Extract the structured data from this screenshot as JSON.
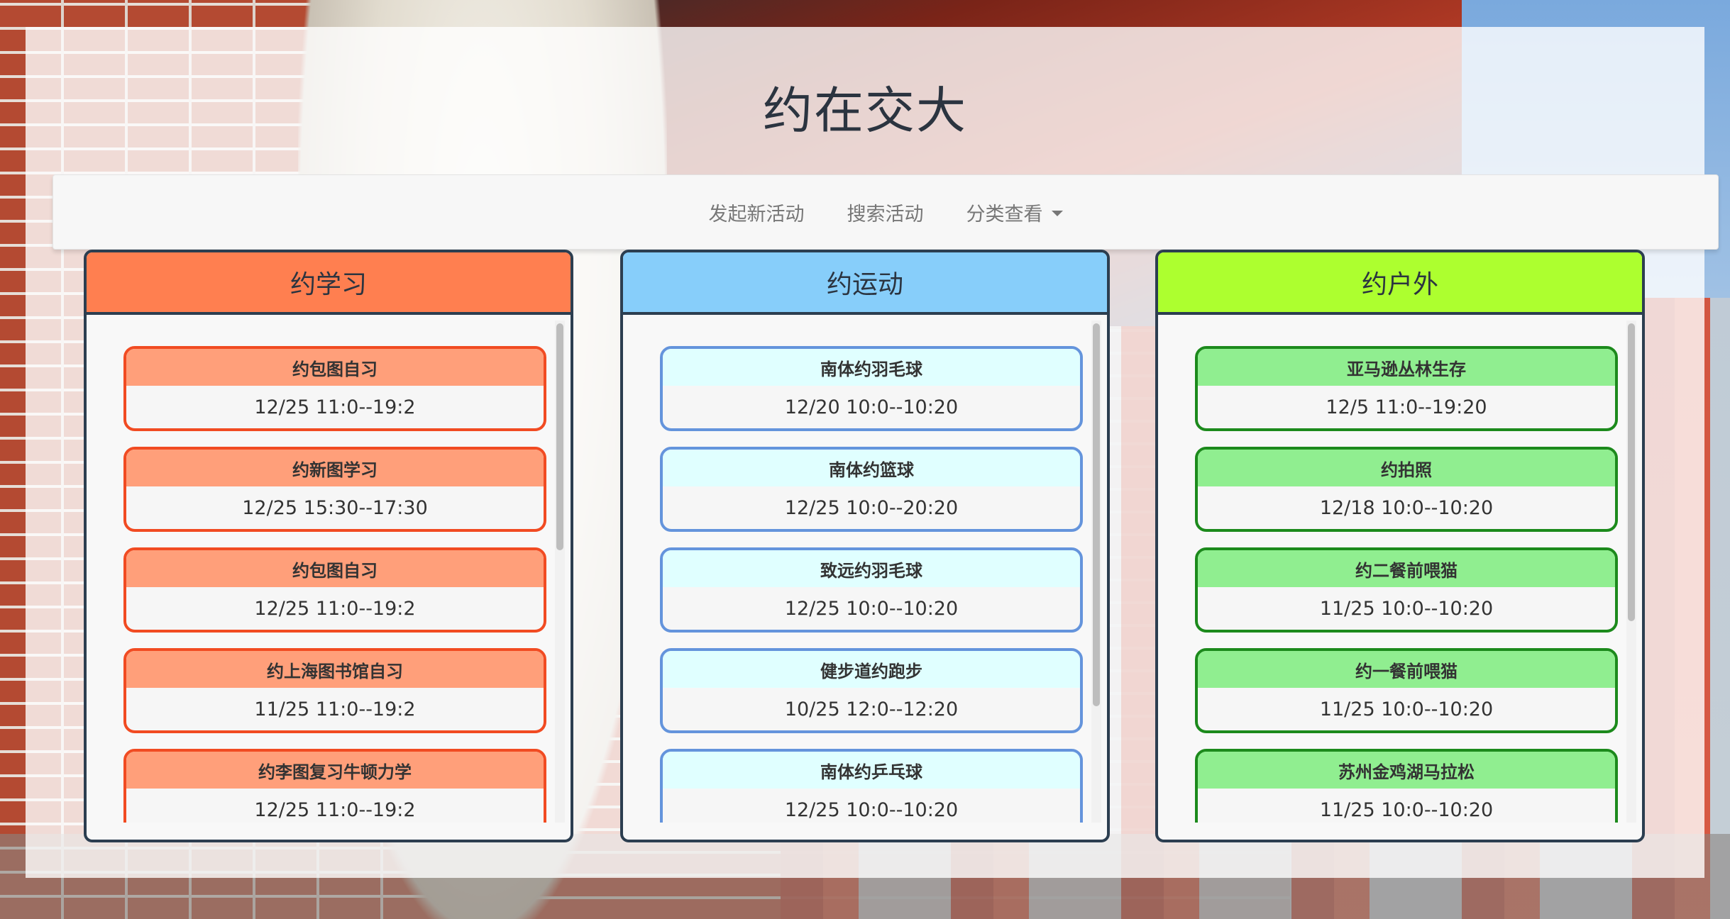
{
  "app": {
    "title": "约在交大"
  },
  "nav": {
    "items": [
      "发起新活动",
      "搜索活动"
    ],
    "dropdown_label": "分类查看"
  },
  "colors": {
    "study_header": "#ff7f50",
    "sport_header": "#87cefa",
    "outdoor_header": "#adff2f",
    "panel_border": "#2c3e50"
  },
  "columns": [
    {
      "title": "约学习",
      "activities": [
        {
          "name": "约包图自习",
          "time": "12/25 11:0--19:2"
        },
        {
          "name": "约新图学习",
          "time": "12/25 15:30--17:30"
        },
        {
          "name": "约包图自习",
          "time": "12/25 11:0--19:2"
        },
        {
          "name": "约上海图书馆自习",
          "time": "11/25 11:0--19:2"
        },
        {
          "name": "约李图复习牛顿力学",
          "time": "12/25 11:0--19:2"
        }
      ]
    },
    {
      "title": "约运动",
      "activities": [
        {
          "name": "南体约羽毛球",
          "time": "12/20 10:0--10:20"
        },
        {
          "name": "南体约篮球",
          "time": "12/25 10:0--20:20"
        },
        {
          "name": "致远约羽毛球",
          "time": "12/25 10:0--10:20"
        },
        {
          "name": "健步道约跑步",
          "time": "10/25 12:0--12:20"
        },
        {
          "name": "南体约乒乓球",
          "time": "12/25 10:0--10:20"
        }
      ]
    },
    {
      "title": "约户外",
      "activities": [
        {
          "name": "亚马逊丛林生存",
          "time": "12/5 11:0--19:20"
        },
        {
          "name": "约拍照",
          "time": "12/18 10:0--10:20"
        },
        {
          "name": "约二餐前喂猫",
          "time": "11/25 10:0--10:20"
        },
        {
          "name": "约一餐前喂猫",
          "time": "11/25 10:0--10:20"
        },
        {
          "name": "苏州金鸡湖马拉松",
          "time": "11/25 10:0--10:20"
        }
      ]
    }
  ]
}
